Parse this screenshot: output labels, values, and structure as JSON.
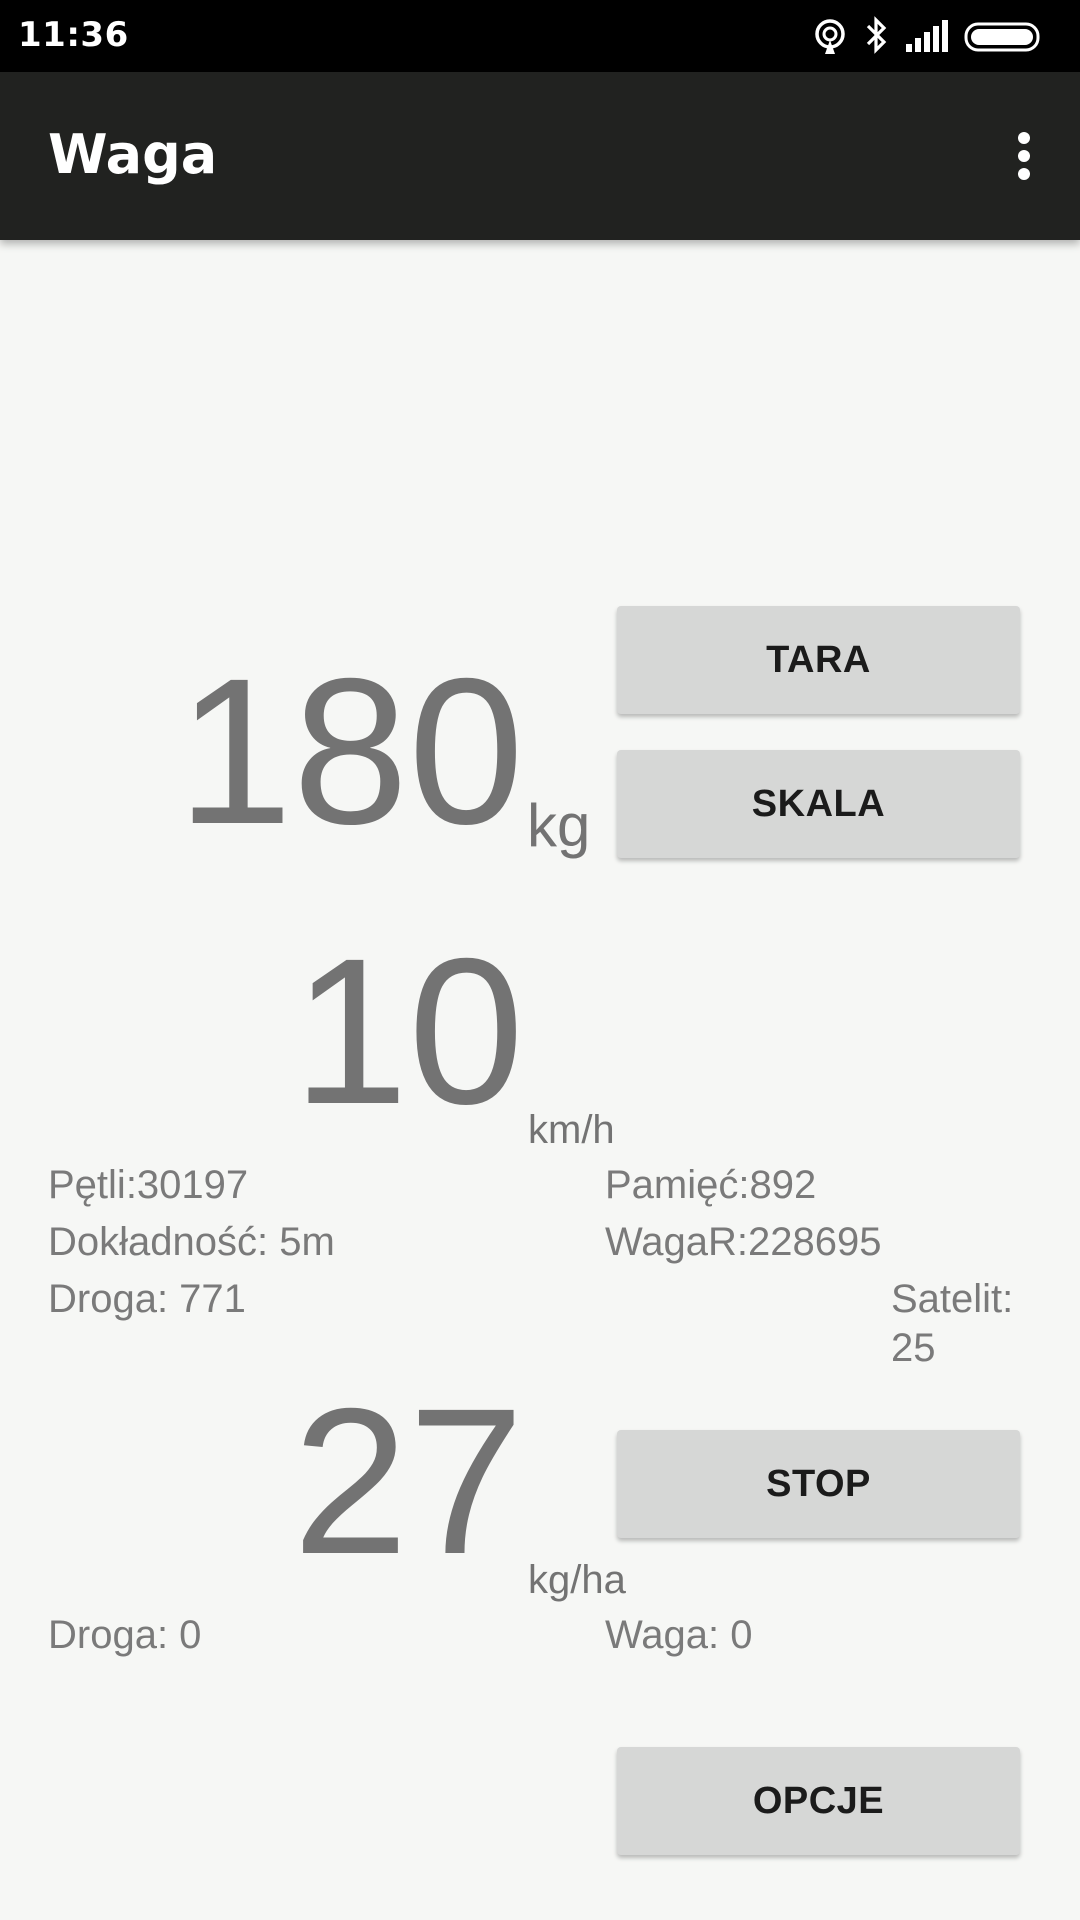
{
  "status_bar": {
    "time": "11:36",
    "icons": [
      "hotspot-icon",
      "bluetooth-icon",
      "signal-icon",
      "battery-icon"
    ]
  },
  "app_bar": {
    "title": "Waga",
    "menu_icon": "overflow-menu-icon"
  },
  "weight": {
    "value": "180",
    "unit": "kg"
  },
  "speed": {
    "value": "10",
    "unit": "km/h"
  },
  "rate": {
    "value": "27",
    "unit": "kg/ha"
  },
  "buttons": {
    "tara": "TARA",
    "skala": "SKALA",
    "stop": "STOP",
    "opcje": "OPCJE"
  },
  "stats": {
    "petli": "Pętli:30197",
    "pamiec": "Pamięć:892",
    "dokladnosc": "Dokładność: 5m",
    "wagar": "WagaR:228695",
    "droga": "Droga: 771",
    "satelit_label": "Satelit:",
    "satelit_value": "25"
  },
  "bottom_stats": {
    "droga": "Droga: 0",
    "waga": "Waga: 0"
  },
  "colors": {
    "status_bar": "#000000",
    "app_bar": "#212220",
    "background": "#f6f7f5",
    "number_text": "#737373",
    "button_bg": "#d6d7d6"
  }
}
